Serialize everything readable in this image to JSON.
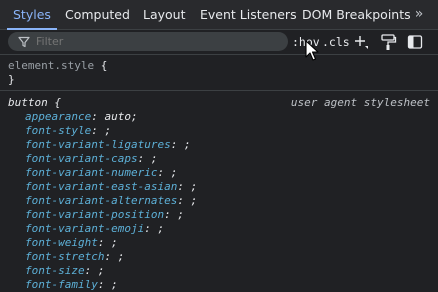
{
  "tabs": [
    {
      "label": "Styles",
      "active": true
    },
    {
      "label": "Computed",
      "active": false
    },
    {
      "label": "Layout",
      "active": false
    },
    {
      "label": "Event Listeners",
      "active": false
    },
    {
      "label": "DOM Breakpoints",
      "active": false
    }
  ],
  "tab_overflow": "»",
  "toolbar": {
    "filter_placeholder": "Filter",
    "filter_value": "",
    "hov_label": ":hov",
    "cls_label": ".cls"
  },
  "element_style": {
    "selector": "element.style",
    "open": "{",
    "close": "}"
  },
  "button_rule": {
    "selector": "button",
    "open": "{",
    "origin": "user agent stylesheet",
    "declarations": [
      {
        "prop": "appearance",
        "value": "auto;"
      },
      {
        "prop": "font-style",
        "value": ";"
      },
      {
        "prop": "font-variant-ligatures",
        "value": ";"
      },
      {
        "prop": "font-variant-caps",
        "value": ";"
      },
      {
        "prop": "font-variant-numeric",
        "value": ";"
      },
      {
        "prop": "font-variant-east-asian",
        "value": ";"
      },
      {
        "prop": "font-variant-alternates",
        "value": ";"
      },
      {
        "prop": "font-variant-position",
        "value": ";"
      },
      {
        "prop": "font-variant-emoji",
        "value": ";"
      },
      {
        "prop": "font-weight",
        "value": ";"
      },
      {
        "prop": "font-stretch",
        "value": ";"
      },
      {
        "prop": "font-size",
        "value": ";"
      },
      {
        "prop": "font-family",
        "value": ";"
      }
    ]
  },
  "colors": {
    "background": "#202124",
    "tab_active": "#8ab4f8",
    "property": "#5db0d7",
    "text": "#e8eaed"
  }
}
